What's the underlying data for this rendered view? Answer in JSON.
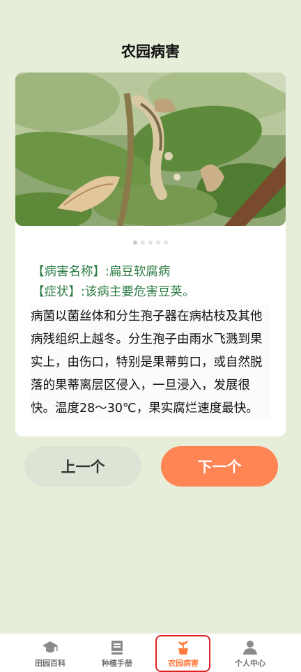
{
  "page": {
    "title": "农园病害"
  },
  "disease": {
    "name_label": "【病害名称】",
    "name_value": ":扁豆软腐病",
    "symptom_label": "【症状】",
    "symptom_value": ":该病主要危害豆荚。",
    "description": "病菌以菌丝体和分生孢子器在病枯枝及其他病残组织上越冬。分生孢子由雨水飞溅到果实上，由伤口，特别是果蒂剪口，或自然脱落的果蒂离层区侵入，一旦浸入，发展很快。温度28～30℃，果实腐烂速度最快。"
  },
  "carousel": {
    "count": 5,
    "active": 0
  },
  "buttons": {
    "prev": "上一个",
    "next": "下一个"
  },
  "tabs": [
    {
      "label": "田园百科",
      "icon": "graduation-cap-icon"
    },
    {
      "label": "种植手册",
      "icon": "book-icon"
    },
    {
      "label": "农园病害",
      "icon": "potted-plant-icon",
      "active": true
    },
    {
      "label": "个人中心",
      "icon": "person-icon"
    }
  ],
  "colors": {
    "accent": "#ff8555",
    "label_green": "#2e7d45",
    "background": "#e6eed9"
  }
}
